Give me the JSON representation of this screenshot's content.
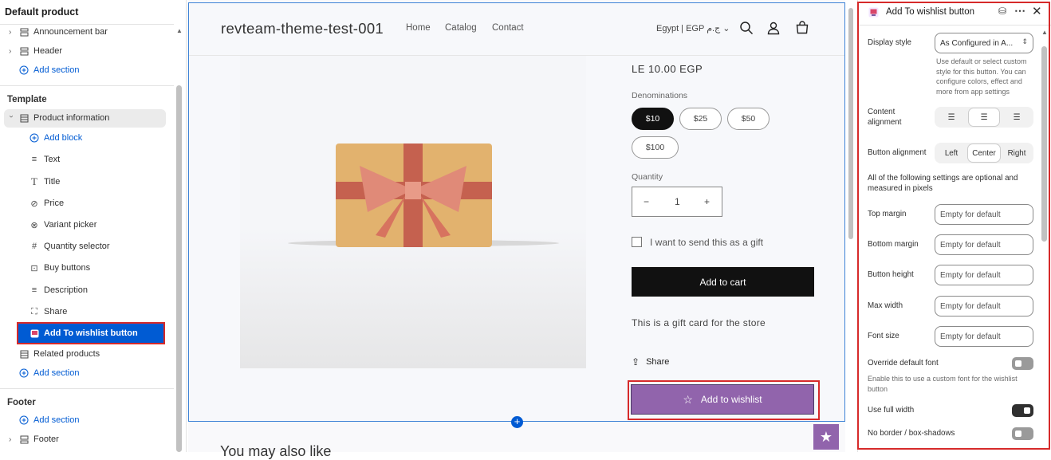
{
  "left": {
    "header": "Default product",
    "header_items": [
      {
        "label": "Announcement bar",
        "icon": "section-icon"
      },
      {
        "label": "Header",
        "icon": "section-icon"
      }
    ],
    "add_section": "Add section",
    "template_title": "Template",
    "product_info": "Product information",
    "add_block": "Add block",
    "blocks": [
      "Text",
      "Title",
      "Price",
      "Variant picker",
      "Quantity selector",
      "Buy buttons",
      "Description",
      "Share",
      "Add To wishlist button"
    ],
    "related": "Related products",
    "footer_title": "Footer",
    "footer_item": "Footer"
  },
  "store": {
    "name": "revteam-theme-test-001",
    "nav": [
      "Home",
      "Catalog",
      "Contact"
    ],
    "currency": "Egypt | EGP ج.م",
    "price": "LE 10.00 EGP",
    "denominations_label": "Denominations",
    "denominations": [
      "$10",
      "$25",
      "$50",
      "$100"
    ],
    "selected_denomination": "$10",
    "quantity_label": "Quantity",
    "quantity": "1",
    "minus": "−",
    "plus": "+",
    "gift_checkbox": "I want to send this as a gift",
    "add_to_cart": "Add to cart",
    "description": "This is a gift card for the store",
    "share": "Share",
    "wishlist": "Add to wishlist",
    "below_fold": "You may also like"
  },
  "panel": {
    "title": "Add To wishlist button",
    "display_style_label": "Display style",
    "display_style_value": "As Configured in A...",
    "display_style_help": "Use default or select custom style for this button. You can configure colors, effect and more from app settings",
    "content_alignment_label": "Content alignment",
    "button_alignment_label": "Button alignment",
    "button_alignment_options": [
      "Left",
      "Center",
      "Right"
    ],
    "button_alignment_selected": "Center",
    "optional_note": "All of the following settings are optional and measured in pixels",
    "fields": [
      {
        "label": "Top margin",
        "placeholder": "Empty for default"
      },
      {
        "label": "Bottom margin",
        "placeholder": "Empty for default"
      },
      {
        "label": "Button height",
        "placeholder": "Empty for default"
      },
      {
        "label": "Max width",
        "placeholder": "Empty for default"
      },
      {
        "label": "Font size",
        "placeholder": "Empty for default"
      }
    ],
    "override_font_label": "Override default font",
    "override_font_help": "Enable this to use a custom font for the wishlist button",
    "override_font_on": false,
    "full_width_label": "Use full width",
    "full_width_on": true,
    "no_border_label": "No border / box-shadows",
    "no_border_on": false
  },
  "colors": {
    "accent": "#005bd3",
    "wishlist": "#9164ac",
    "highlight": "#d62a2a",
    "selected_row": "#005bd3"
  }
}
